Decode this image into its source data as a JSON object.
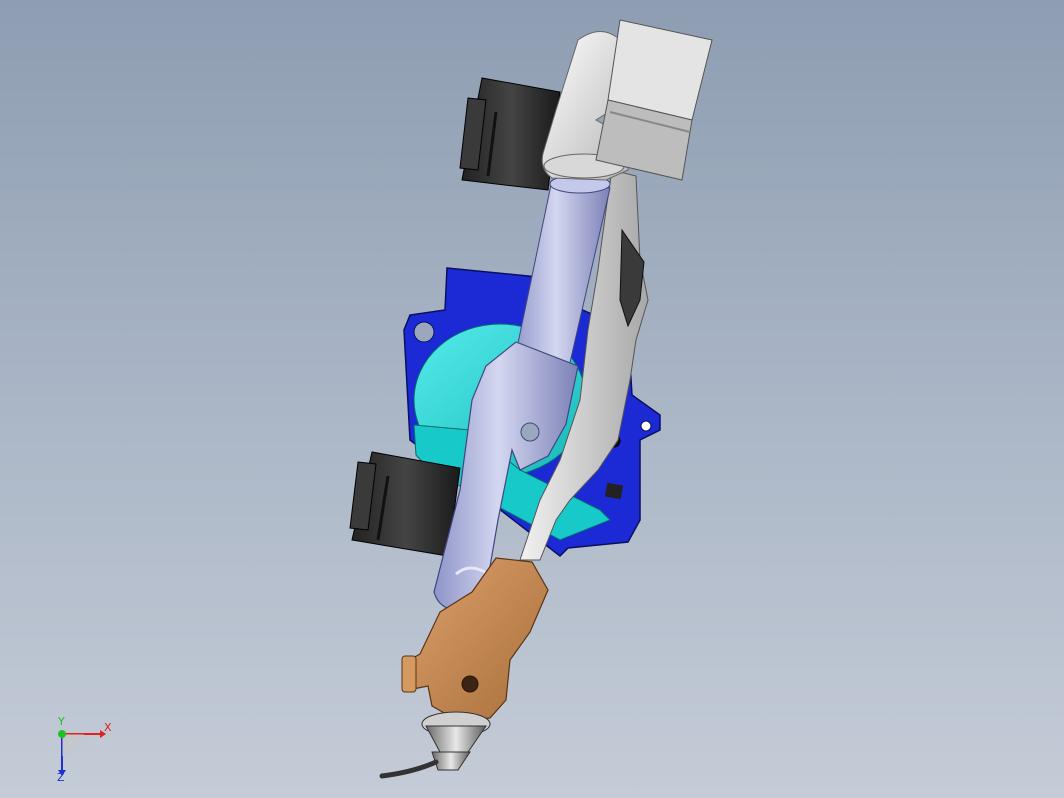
{
  "viewport": {
    "background_top": "#8e9db2",
    "background_bottom": "#c4ccd7"
  },
  "model": {
    "parts": [
      {
        "name": "upper-motor",
        "color": "#2b2b2b"
      },
      {
        "name": "lower-motor",
        "color": "#2b2b2b"
      },
      {
        "name": "base-flange",
        "color": "#1c2ad6"
      },
      {
        "name": "rotary-joint",
        "color": "#1ed8d8"
      },
      {
        "name": "arm-bracket",
        "color": "#d6d6d6"
      },
      {
        "name": "cylinder-rod",
        "color": "#a4a9d4"
      },
      {
        "name": "cylinder-head",
        "color": "#d0d0d0"
      },
      {
        "name": "cylinder-end-block",
        "color": "#c8c8c8"
      },
      {
        "name": "lever-arm",
        "color": "#a2a6d0"
      },
      {
        "name": "torch-clamp",
        "color": "#c48a55"
      },
      {
        "name": "torch-nozzle",
        "color": "#b0b0b0"
      },
      {
        "name": "cable",
        "color": "#333333"
      }
    ]
  },
  "triad": {
    "x_label": "X",
    "y_label": "Y",
    "z_label": "Z",
    "x_color": "#e02020",
    "y_color": "#20c020",
    "z_color": "#2030d0"
  }
}
